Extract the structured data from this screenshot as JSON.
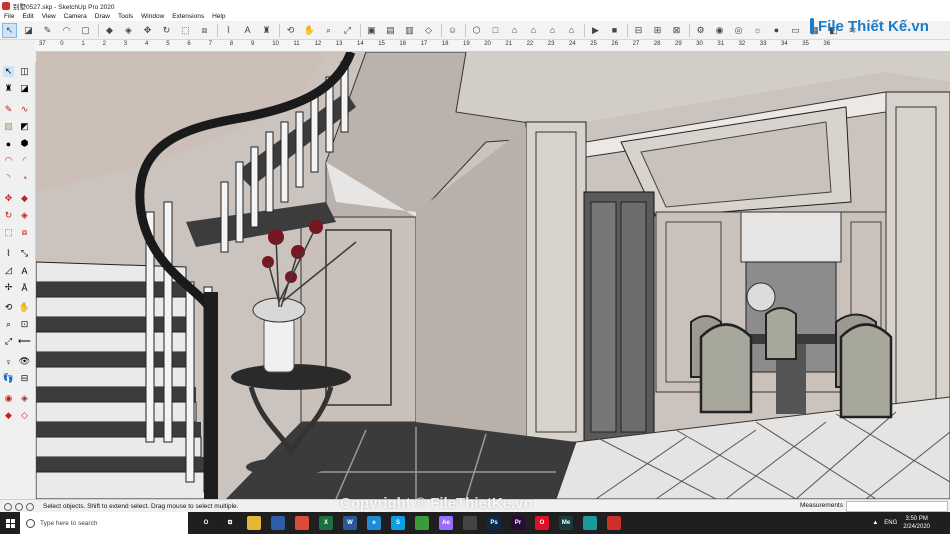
{
  "window": {
    "title": "别墅0527.skp - SketchUp Pro 2020"
  },
  "menu": [
    "File",
    "Edit",
    "View",
    "Camera",
    "Draw",
    "Tools",
    "Window",
    "Extensions",
    "Help"
  ],
  "logo": {
    "text": "File Thiết Kế.vn"
  },
  "ruler": {
    "ticks": [
      "37",
      "0",
      "1",
      "2",
      "3",
      "4",
      "5",
      "6",
      "7",
      "8",
      "9",
      "10",
      "11",
      "12",
      "13",
      "14",
      "15",
      "16",
      "17",
      "18",
      "19",
      "20",
      "21",
      "22",
      "23",
      "24",
      "25",
      "26",
      "27",
      "28",
      "29",
      "30",
      "31",
      "32",
      "33",
      "34",
      "35",
      "36"
    ]
  },
  "status": {
    "hint": "Select objects. Shift to extend select. Drag mouse to select multiple.",
    "measurements_label": "Measurements"
  },
  "watermark": {
    "text": "Copyright © FileThietKe.vn"
  },
  "taskbar": {
    "search_placeholder": "Type here to search",
    "apps": [
      {
        "name": "cortana",
        "color": "#1f1f1f",
        "label": "O"
      },
      {
        "name": "task-view",
        "color": "#1f1f1f",
        "label": "⧉"
      },
      {
        "name": "file-explorer",
        "color": "#e6b635",
        "label": ""
      },
      {
        "name": "store",
        "color": "#2f5ea8",
        "label": ""
      },
      {
        "name": "chrome",
        "color": "#dd4b39",
        "label": ""
      },
      {
        "name": "excel",
        "color": "#1d6f42",
        "label": "X"
      },
      {
        "name": "word",
        "color": "#2b579a",
        "label": "W"
      },
      {
        "name": "edge",
        "color": "#1f8ad6",
        "label": "e"
      },
      {
        "name": "skype",
        "color": "#0aa0e5",
        "label": "S"
      },
      {
        "name": "zalo",
        "color": "#3a9b3a",
        "label": ""
      },
      {
        "name": "after-effects",
        "color": "#9a6cff",
        "label": "Ae"
      },
      {
        "name": "calculator",
        "color": "#444",
        "label": ""
      },
      {
        "name": "photoshop",
        "color": "#0b2a4a",
        "label": "Ps"
      },
      {
        "name": "premiere",
        "color": "#2a0a3a",
        "label": "Pr"
      },
      {
        "name": "opera",
        "color": "#e0102b",
        "label": "O"
      },
      {
        "name": "media-encoder",
        "color": "#173a3a",
        "label": "Me"
      },
      {
        "name": "photos",
        "color": "#1a9a9a",
        "label": ""
      },
      {
        "name": "sketchup",
        "color": "#d0302c",
        "label": ""
      }
    ],
    "language": "ENG",
    "time": "3:50 PM",
    "date": "2/24/2020"
  },
  "colors": {
    "wall": "#cbc3bd",
    "trim": "#f2f2f2",
    "floor_dark": "#3a3a3a",
    "accent": "#1a7cc9"
  }
}
